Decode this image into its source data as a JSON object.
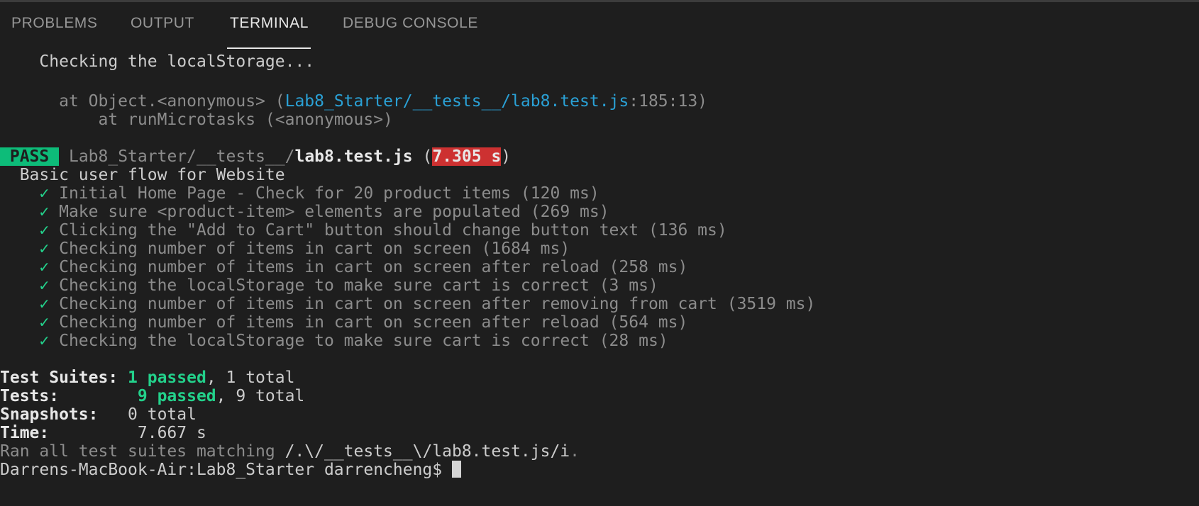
{
  "tabs": {
    "problems": "PROBLEMS",
    "output": "OUTPUT",
    "terminal": "TERMINAL",
    "debug_console": "DEBUG CONSOLE"
  },
  "terminal": {
    "log_message": "Checking the localStorage...",
    "stack": {
      "frame1_prefix": "at Object.<anonymous> (",
      "frame1_file": "Lab8_Starter/__tests__/lab8.test.js",
      "frame1_suffix": ":185:13)",
      "frame2": "at runMicrotasks (<anonymous>)"
    },
    "result": {
      "badge": "PASS",
      "path_dir": "Lab8_Starter/__tests__/",
      "path_file": "lab8.test.js",
      "open_paren": "(",
      "duration": "7.305 s",
      "close_paren": ")"
    },
    "describe": "Basic user flow for Website",
    "check_glyph": "✓",
    "tests": [
      "Initial Home Page - Check for 20 product items (120 ms)",
      "Make sure <product-item> elements are populated (269 ms)",
      "Clicking the \"Add to Cart\" button should change button text (136 ms)",
      "Checking number of items in cart on screen (1684 ms)",
      "Checking number of items in cart on screen after reload (258 ms)",
      "Checking the localStorage to make sure cart is correct (3 ms)",
      "Checking number of items in cart on screen after removing from cart (3519 ms)",
      "Checking number of items in cart on screen after reload (564 ms)",
      "Checking the localStorage to make sure cart is correct (28 ms)"
    ],
    "summary": {
      "suites_label": "Test Suites:",
      "suites_passed": "1 passed",
      "suites_total": ", 1 total",
      "tests_label": "Tests:",
      "tests_passed": "9 passed",
      "tests_total": ", 9 total",
      "snapshots_label": "Snapshots:",
      "snapshots_value": "0 total",
      "time_label": "Time:",
      "time_value": "7.667 s"
    },
    "ran_prefix": "Ran all test suites matching ",
    "ran_pattern": "/.\\/__tests__\\/lab8.test.js/i",
    "ran_suffix": ".",
    "prompt": "Darrens-MacBook-Air:Lab8_Starter darrencheng$ "
  },
  "colors": {
    "background": "#1e1e1e",
    "pass_badge": "#0dbc79",
    "slow_badge": "#cd3131",
    "link": "#2aa1d6",
    "success": "#23d18b"
  }
}
